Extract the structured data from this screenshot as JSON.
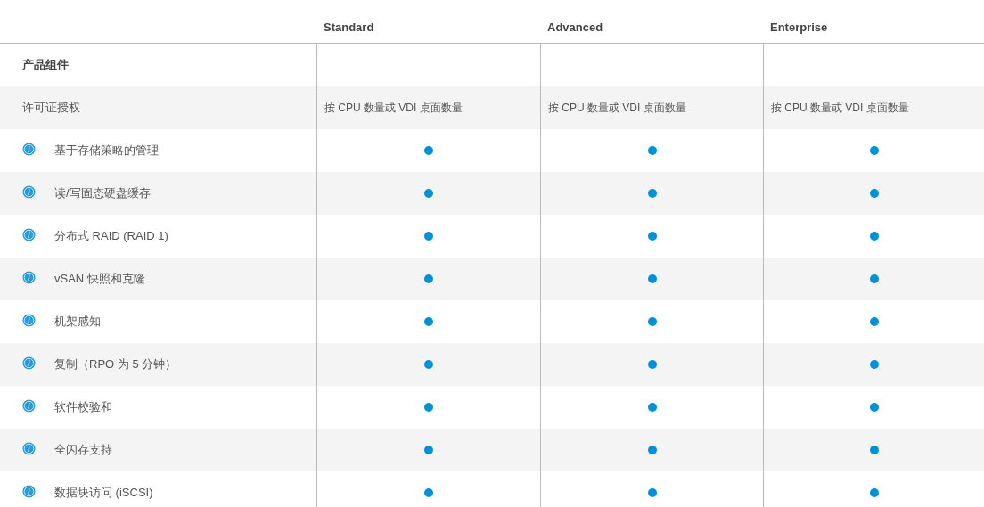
{
  "table": {
    "columns": [
      "Standard",
      "Advanced",
      "Enterprise"
    ],
    "section": "产品组件",
    "licensing": {
      "label": "许可证授权",
      "values": [
        "按 CPU 数量或 VDI 桌面数量",
        "按 CPU 数量或 VDI 桌面数量",
        "按 CPU 数量或 VDI 桌面数量"
      ]
    },
    "features": [
      {
        "label": "基于存储策略的管理",
        "included": [
          true,
          true,
          true
        ]
      },
      {
        "label": "读/写固态硬盘缓存",
        "included": [
          true,
          true,
          true
        ]
      },
      {
        "label": "分布式 RAID (RAID 1)",
        "included": [
          true,
          true,
          true
        ]
      },
      {
        "label": "vSAN 快照和克隆",
        "included": [
          true,
          true,
          true
        ]
      },
      {
        "label": "机架感知",
        "included": [
          true,
          true,
          true
        ]
      },
      {
        "label": "复制（RPO 为 5 分钟）",
        "included": [
          true,
          true,
          true
        ]
      },
      {
        "label": "软件校验和",
        "included": [
          true,
          true,
          true
        ]
      },
      {
        "label": "全闪存支持",
        "included": [
          true,
          true,
          true
        ]
      },
      {
        "label": "数据块访问 (iSCSI)",
        "included": [
          true,
          true,
          true
        ]
      }
    ]
  }
}
